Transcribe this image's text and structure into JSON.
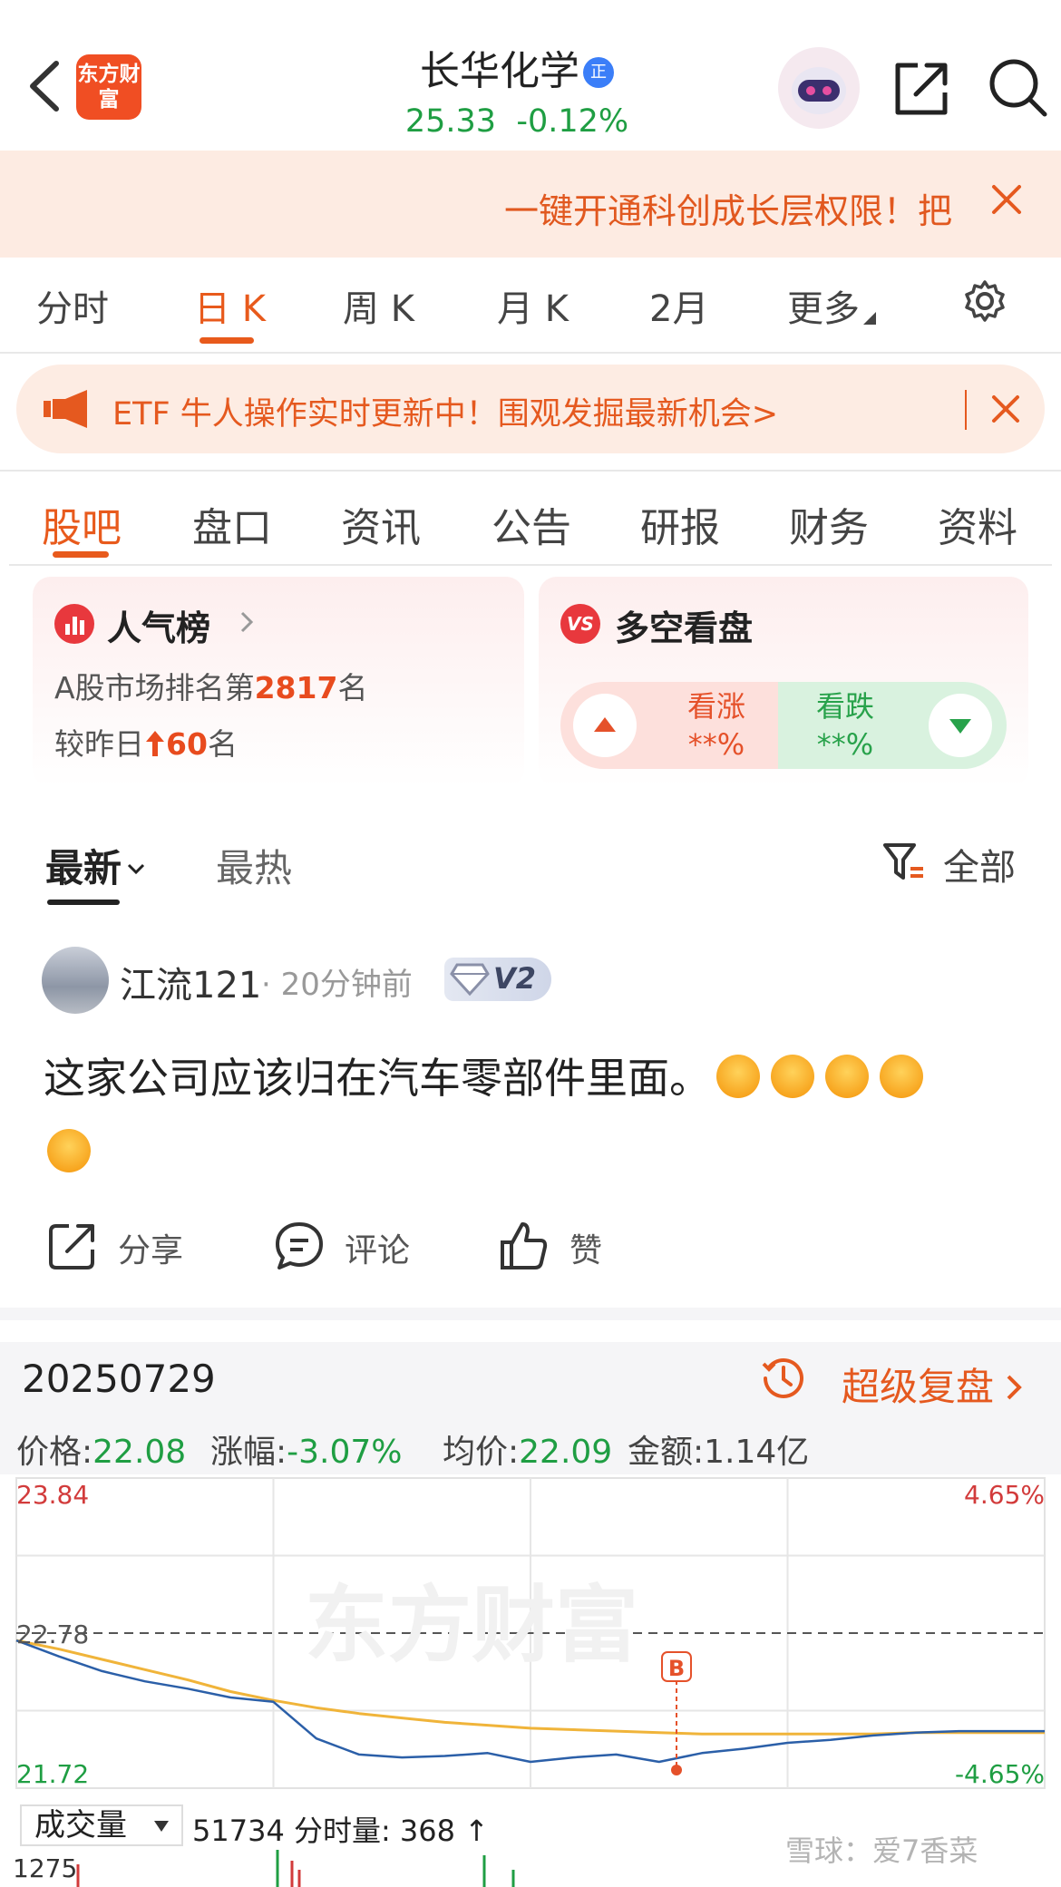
{
  "header": {
    "logo_text": "东方财富",
    "title": "长华化学",
    "title_badge": "正",
    "price": "25.33",
    "change": "-0.12%"
  },
  "promo": {
    "text": "一键开通科创成长层权限！把"
  },
  "period_tabs": [
    "分时",
    "日 K",
    "周 K",
    "月 K",
    "2月",
    "更多"
  ],
  "notice": {
    "text": "ETF 牛人操作实时更新中！围观发掘最新机会>"
  },
  "section_tabs": [
    "股吧",
    "盘口",
    "资讯",
    "公告",
    "研报",
    "财务",
    "资料"
  ],
  "popularity": {
    "title": "人气榜",
    "rank_prefix": "A股市场排名第",
    "rank": "2817",
    "rank_suffix": "名",
    "change_prefix": "较昨日",
    "change_value": "60",
    "change_suffix": "名"
  },
  "sentiment": {
    "title": "多空看盘",
    "up_label": "看涨",
    "up_value": "**%",
    "down_label": "看跌",
    "down_value": "**%"
  },
  "feed": {
    "sort_latest": "最新",
    "sort_hot": "最热",
    "filter": "全部"
  },
  "post": {
    "user": "江流121",
    "time": "· 20分钟前",
    "level": "V2",
    "text": "这家公司应该归在汽车零部件里面。",
    "actions": {
      "share": "分享",
      "comment": "评论",
      "like": "赞"
    }
  },
  "intraday": {
    "date": "20250729",
    "replay": "超级复盘",
    "price_label": "价格:",
    "price": "22.08",
    "change_label": "涨幅:",
    "change": "-3.07%",
    "avg_label": "均价:",
    "avg": "22.09",
    "amount_label": "金额:",
    "amount": "1.14亿",
    "watermark": "东方财富",
    "marker": "B",
    "volume_select": "成交量",
    "volume_text": "51734 分时量: 368 ↑",
    "vol_axis": "1275",
    "watermark2": "雪球：爱7香菜"
  },
  "chart_data": {
    "type": "line",
    "y_max_label": "23.84",
    "y_mid_label": "22.78",
    "y_min_label": "21.72",
    "pct_max_label": "4.65%",
    "pct_min_label": "-4.65%",
    "ylim": [
      21.72,
      23.84
    ],
    "prev_close": 22.78,
    "x": [
      0,
      10,
      20,
      30,
      40,
      50,
      60,
      70,
      80,
      90,
      100,
      110,
      120,
      130,
      140,
      150,
      160,
      170,
      180,
      190,
      200,
      210,
      220,
      230,
      240
    ],
    "series": [
      {
        "values": [
          22.73,
          22.62,
          22.52,
          22.45,
          22.4,
          22.34,
          22.31,
          22.06,
          21.95,
          21.93,
          21.94,
          21.96,
          21.9,
          21.93,
          21.95,
          21.9,
          21.96,
          21.99,
          22.03,
          22.05,
          22.08,
          22.1,
          22.11,
          22.11,
          22.11
        ]
      },
      {
        "values": [
          22.73,
          22.67,
          22.6,
          22.53,
          22.46,
          22.38,
          22.32,
          22.27,
          22.23,
          22.2,
          22.17,
          22.15,
          22.13,
          22.12,
          22.11,
          22.1,
          22.09,
          22.09,
          22.09,
          22.09,
          22.09,
          22.1,
          22.1,
          22.1,
          22.1
        ]
      }
    ],
    "colors": [
      "#2b5fa8",
      "#f0b43a"
    ]
  }
}
